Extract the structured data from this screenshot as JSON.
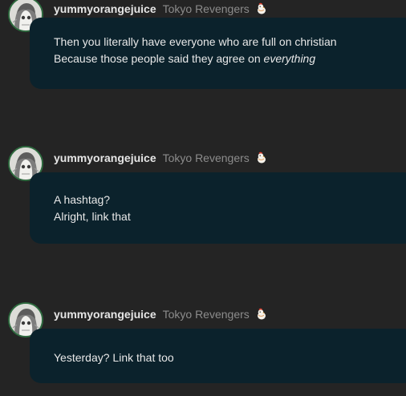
{
  "posts": [
    {
      "username": "yummyorangejuice",
      "group": "Tokyo Revengers",
      "badge_icon": "chick-icon",
      "lines": [
        {
          "text": "Then you literally have everyone who are full on christian",
          "emphasis": ""
        },
        {
          "text": "Because those people said they agree on ",
          "emphasis": "everything"
        }
      ]
    },
    {
      "username": "yummyorangejuice",
      "group": "Tokyo Revengers",
      "badge_icon": "chick-icon",
      "lines": [
        {
          "text": "A hashtag?",
          "emphasis": ""
        },
        {
          "text": "Alright, link that",
          "emphasis": ""
        }
      ]
    },
    {
      "username": "yummyorangejuice",
      "group": "Tokyo Revengers",
      "badge_icon": "chick-icon",
      "lines": [
        {
          "text": "Yesterday? Link that too",
          "emphasis": ""
        }
      ]
    }
  ],
  "colors": {
    "background": "#242424",
    "bubble": "#0b222c",
    "avatar_ring": "#2e6b3f",
    "username": "#e6e6e6",
    "group": "#8c8c8c"
  }
}
